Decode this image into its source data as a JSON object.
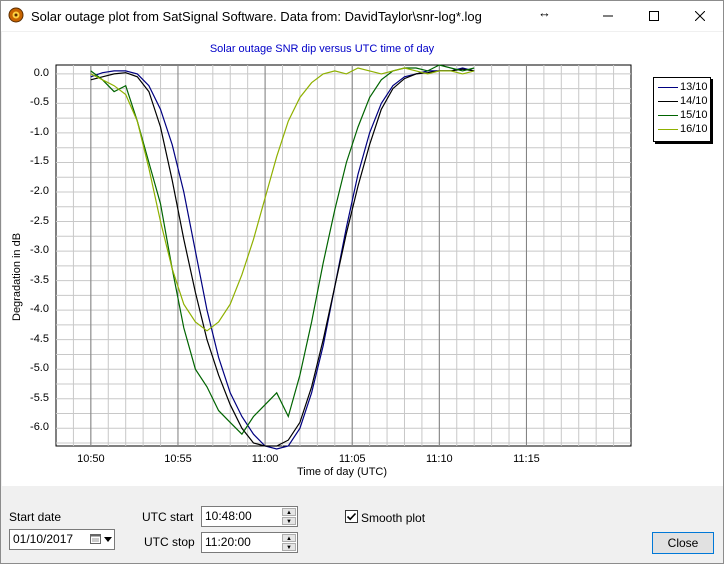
{
  "window": {
    "title": "Solar outage plot from SatSignal Software.  Data from: DavidTaylor\\snr-log*.log",
    "resize_glyph": "↔"
  },
  "plot": {
    "title": "Solar outage SNR dip versus UTC time of day",
    "ylabel": "Degradation in dB",
    "xlabel": "Time of day (UTC)",
    "yticks": [
      "0.0",
      "-0.5",
      "-1.0",
      "-1.5",
      "-2.0",
      "-2.5",
      "-3.0",
      "-3.5",
      "-4.0",
      "-4.5",
      "-5.0",
      "-5.5",
      "-6.0"
    ],
    "xticks": [
      "10:50",
      "10:55",
      "11:00",
      "11:05",
      "11:10",
      "11:15"
    ]
  },
  "chart_data": {
    "type": "line",
    "title": "Solar outage SNR dip versus UTC time of day",
    "xlabel": "Time of day (UTC)",
    "ylabel": "Degradation in dB",
    "xlim": [
      10.8,
      11.35
    ],
    "ylim": [
      -6.3,
      0.15
    ],
    "grid": true,
    "legend_position": "right",
    "series": [
      {
        "name": "13/10",
        "color": "#000080",
        "x": [
          10.8,
          10.81,
          10.82,
          10.83,
          10.84,
          10.85,
          10.86,
          10.87,
          10.88,
          10.89,
          10.9,
          10.91,
          10.92,
          10.93,
          10.94,
          10.95,
          10.96,
          10.97,
          10.98,
          10.99,
          11.0,
          11.01,
          11.02,
          11.03,
          11.04,
          11.05,
          11.06,
          11.07,
          11.08,
          11.09,
          11.1,
          11.11,
          11.12,
          11.13
        ],
        "y": [
          -0.05,
          0.02,
          0.05,
          0.05,
          0.0,
          -0.2,
          -0.6,
          -1.2,
          -2.0,
          -3.0,
          -4.0,
          -4.8,
          -5.4,
          -5.8,
          -6.1,
          -6.3,
          -6.35,
          -6.3,
          -6.0,
          -5.4,
          -4.6,
          -3.6,
          -2.6,
          -1.7,
          -1.0,
          -0.5,
          -0.2,
          -0.05,
          0.0,
          0.05,
          0.05,
          0.05,
          0.1,
          0.05
        ]
      },
      {
        "name": "14/10",
        "color": "#000000",
        "x": [
          10.8,
          10.81,
          10.82,
          10.83,
          10.84,
          10.85,
          10.86,
          10.87,
          10.88,
          10.89,
          10.9,
          10.91,
          10.92,
          10.93,
          10.94,
          10.95,
          10.96,
          10.97,
          10.98,
          10.99,
          11.0,
          11.01,
          11.02,
          11.03,
          11.04,
          11.05,
          11.06,
          11.07,
          11.08,
          11.09,
          11.1,
          11.11,
          11.12,
          11.13
        ],
        "y": [
          -0.1,
          -0.05,
          0.0,
          0.02,
          -0.05,
          -0.3,
          -0.9,
          -1.8,
          -2.8,
          -3.7,
          -4.5,
          -5.1,
          -5.6,
          -6.0,
          -6.25,
          -6.3,
          -6.3,
          -6.2,
          -5.9,
          -5.3,
          -4.5,
          -3.6,
          -2.7,
          -1.9,
          -1.2,
          -0.6,
          -0.25,
          -0.08,
          0.0,
          0.02,
          0.05,
          0.05,
          0.08,
          0.05
        ]
      },
      {
        "name": "15/10",
        "color": "#006400",
        "x": [
          10.8,
          10.81,
          10.82,
          10.83,
          10.84,
          10.85,
          10.86,
          10.87,
          10.88,
          10.89,
          10.9,
          10.91,
          10.92,
          10.93,
          10.94,
          10.95,
          10.96,
          10.97,
          10.98,
          10.99,
          11.0,
          11.01,
          11.02,
          11.03,
          11.04,
          11.05,
          11.06,
          11.07,
          11.08,
          11.09,
          11.1,
          11.11,
          11.12,
          11.13
        ],
        "y": [
          0.05,
          -0.1,
          -0.3,
          -0.2,
          -0.8,
          -1.5,
          -2.2,
          -3.3,
          -4.3,
          -5.0,
          -5.3,
          -5.7,
          -5.9,
          -6.1,
          -5.8,
          -5.6,
          -5.4,
          -5.8,
          -5.1,
          -4.2,
          -3.2,
          -2.3,
          -1.5,
          -0.9,
          -0.4,
          -0.1,
          0.05,
          0.1,
          0.1,
          0.05,
          0.15,
          0.1,
          0.05,
          0.1
        ]
      },
      {
        "name": "16/10",
        "color": "#8fb000",
        "x": [
          10.8,
          10.81,
          10.82,
          10.83,
          10.84,
          10.85,
          10.86,
          10.87,
          10.88,
          10.89,
          10.9,
          10.91,
          10.92,
          10.93,
          10.94,
          10.95,
          10.96,
          10.97,
          10.98,
          10.99,
          11.0,
          11.01,
          11.02,
          11.03,
          11.04,
          11.05,
          11.06,
          11.07,
          11.08,
          11.09,
          11.1,
          11.11,
          11.12,
          11.13
        ],
        "y": [
          0.0,
          -0.1,
          -0.2,
          -0.35,
          -0.8,
          -1.6,
          -2.5,
          -3.3,
          -3.9,
          -4.2,
          -4.35,
          -4.2,
          -3.9,
          -3.4,
          -2.8,
          -2.1,
          -1.4,
          -0.8,
          -0.4,
          -0.15,
          0.0,
          0.05,
          0.0,
          0.1,
          0.05,
          0.0,
          0.05,
          0.1,
          0.05,
          0.0,
          0.05,
          0.05,
          0.0,
          0.05
        ]
      }
    ]
  },
  "legend": {
    "items": [
      {
        "label": "13/10",
        "color": "#000080"
      },
      {
        "label": "14/10",
        "color": "#000000"
      },
      {
        "label": "15/10",
        "color": "#006400"
      },
      {
        "label": "16/10",
        "color": "#8fb000"
      }
    ]
  },
  "controls": {
    "start_date_label": "Start date",
    "start_date_value": "01/10/2017",
    "utc_start_label": "UTC start",
    "utc_start_value": "10:48:00",
    "utc_stop_label": "UTC stop",
    "utc_stop_value": "11:20:00",
    "smooth_plot_label": "Smooth plot",
    "smooth_plot_checked": true,
    "close_label": "Close"
  }
}
